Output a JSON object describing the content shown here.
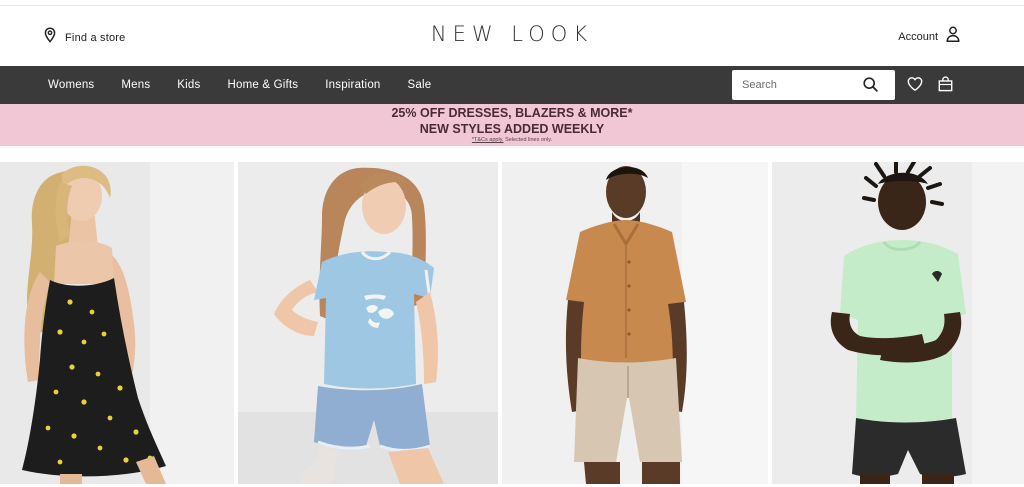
{
  "header": {
    "find_store_label": "Find a store",
    "logo_text": "NEW LOOK",
    "account_label": "Account"
  },
  "nav": {
    "items": [
      {
        "label": "Womens"
      },
      {
        "label": "Mens"
      },
      {
        "label": "Kids"
      },
      {
        "label": "Home & Gifts"
      },
      {
        "label": "Inspiration"
      },
      {
        "label": "Sale"
      }
    ],
    "search_placeholder": "Search"
  },
  "promo": {
    "line1": "25% OFF DRESSES, BLAZERS & MORE*",
    "line2": "NEW STYLES ADDED WEEKLY",
    "terms_link": "*T&Cs apply.",
    "terms_note": "Selected lines only."
  },
  "colors": {
    "nav_bg": "#3a3a3a",
    "promo_bg": "#f2c7d5",
    "promo_text": "#4a2a35"
  },
  "icons": {
    "find_store": "map-pin-icon",
    "account": "user-icon",
    "search": "search-icon",
    "wishlist": "heart-icon",
    "bag": "shopping-bag-icon"
  },
  "tiles": [
    {
      "category": "Womens",
      "subject": "woman-in-black-floral-dress"
    },
    {
      "category": "Girls",
      "subject": "girl-in-blue-tshirt-denim-shorts"
    },
    {
      "category": "Mens",
      "subject": "man-in-tan-shirt-beige-shorts"
    },
    {
      "category": "Boys",
      "subject": "boy-in-mint-tshirt-black-shorts"
    }
  ]
}
